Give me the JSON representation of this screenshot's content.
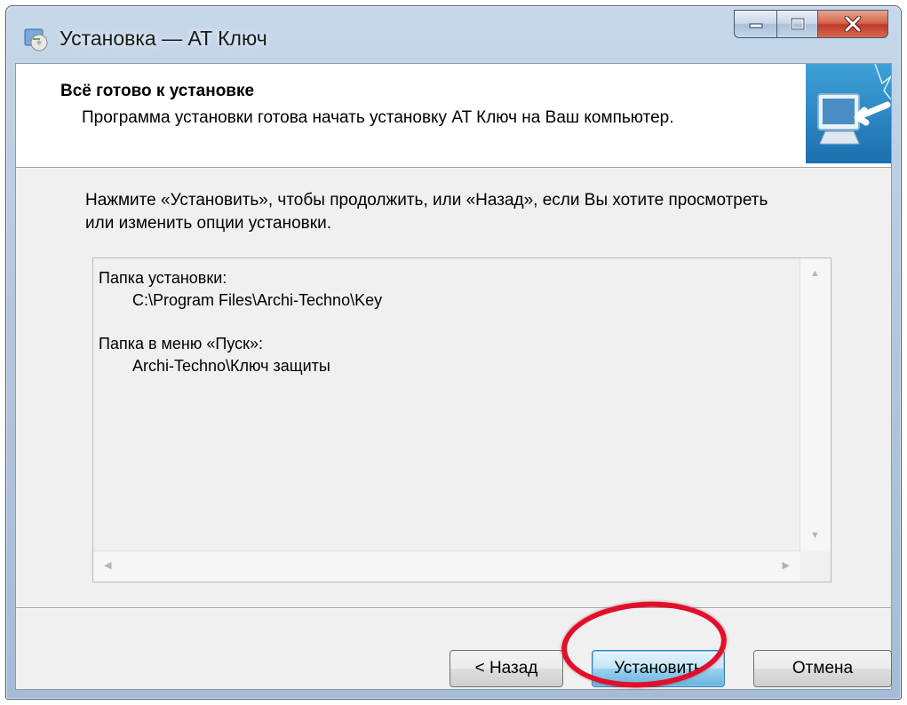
{
  "window": {
    "title": "Установка — AT Ключ",
    "icons": {
      "app": "installer-disc-icon",
      "minimize": "minimize-icon",
      "maximize": "maximize-icon",
      "close": "close-icon"
    },
    "colors": {
      "close_button": "#c1392a",
      "default_button": "#98d1ef",
      "highlight": "#e0102a"
    }
  },
  "header": {
    "title": "Всё готово к установке",
    "description": "Программа установки готова начать установку AT Ключ на Ваш компьютер.",
    "image_icon": "computer-install-arrow-icon"
  },
  "instruction": "Нажмите «Установить», чтобы продолжить, или «Назад», если Вы хотите просмотреть или изменить опции установки.",
  "memo": {
    "install_folder_label": "Папка установки:",
    "install_folder_value": "C:\\Program Files\\Archi-Techno\\Key",
    "start_menu_label": "Папка в меню «Пуск»:",
    "start_menu_value": "Archi-Techno\\Ключ защиты"
  },
  "buttons": {
    "back": "< Назад",
    "install": "Установить",
    "cancel": "Отмена"
  }
}
